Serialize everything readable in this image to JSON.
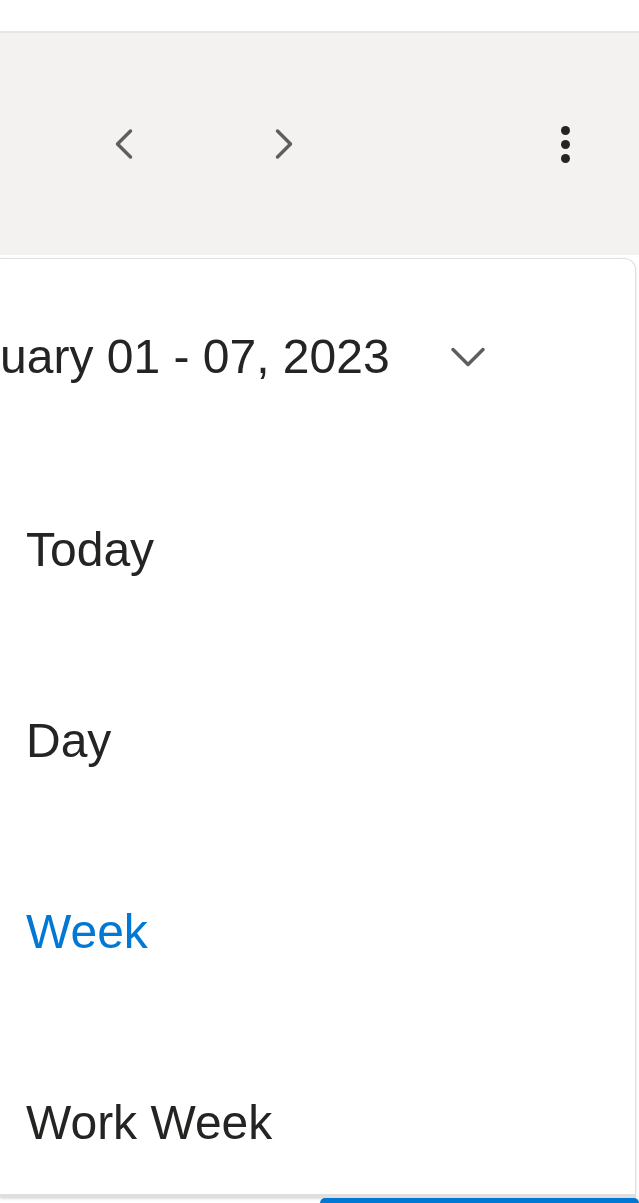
{
  "date_range": {
    "label": "uary 01 - 07, 2023",
    "expanded": true
  },
  "view_menu": [
    {
      "label": "Today",
      "selected": false
    },
    {
      "label": "Day",
      "selected": false
    },
    {
      "label": "Week",
      "selected": true
    },
    {
      "label": "Work Week",
      "selected": false
    }
  ]
}
